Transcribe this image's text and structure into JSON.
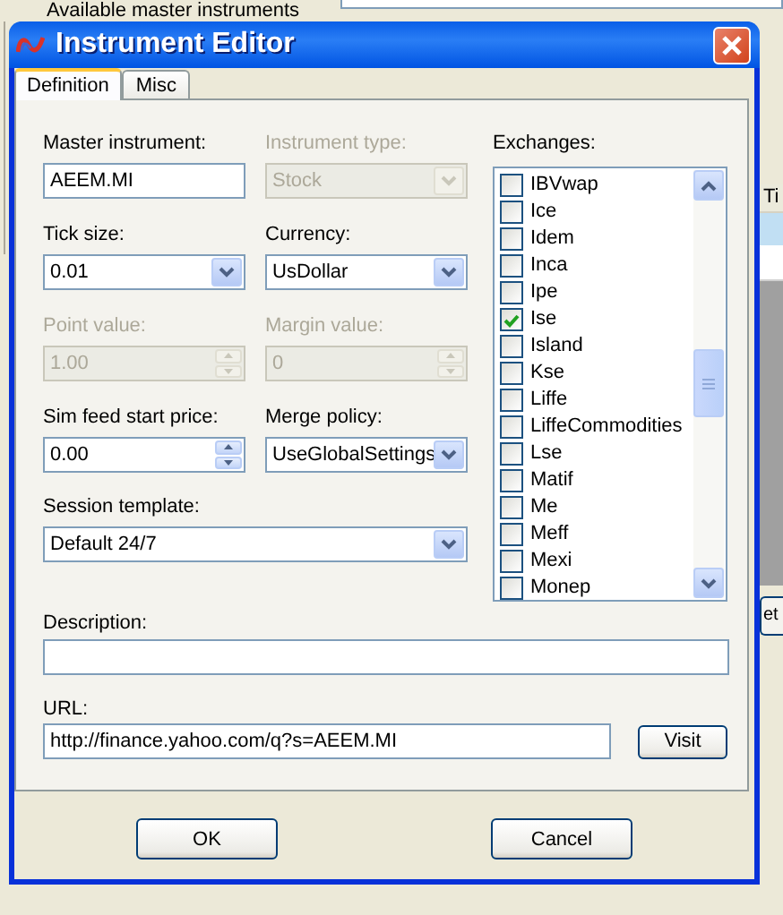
{
  "background": {
    "list_title": "Available master instruments",
    "column_header": "Ti",
    "button": "et"
  },
  "window": {
    "title": "Instrument Editor"
  },
  "tabs": [
    {
      "label": "Definition",
      "selected": true
    },
    {
      "label": "Misc",
      "selected": false
    }
  ],
  "fields": [
    {
      "kind": "text",
      "label": "Master instrument:",
      "value": "AEEM.MI",
      "disabled": false
    },
    {
      "kind": "dropdown",
      "label": "Instrument type:",
      "value": "Stock",
      "disabled": true
    },
    {
      "kind": "dropdown",
      "label": "Tick size:",
      "value": "0.01",
      "disabled": false
    },
    {
      "kind": "dropdown",
      "label": "Currency:",
      "value": "UsDollar",
      "disabled": false
    },
    {
      "kind": "spin",
      "label": "Point value:",
      "value": "1.00",
      "disabled": true
    },
    {
      "kind": "spin",
      "label": "Margin value:",
      "value": "0",
      "disabled": true
    },
    {
      "kind": "spin",
      "label": "Sim feed start price:",
      "value": "0.00",
      "disabled": false
    },
    {
      "kind": "dropdown",
      "label": "Merge policy:",
      "value": "UseGlobalSettings",
      "disabled": false
    },
    {
      "kind": "dropdown",
      "label": "Session template:",
      "value": "Default 24/7",
      "disabled": false
    }
  ],
  "exchanges": {
    "label": "Exchanges:",
    "items": [
      {
        "name": "IBVwap",
        "checked": false
      },
      {
        "name": "Ice",
        "checked": false
      },
      {
        "name": "Idem",
        "checked": false
      },
      {
        "name": "Inca",
        "checked": false
      },
      {
        "name": "Ipe",
        "checked": false
      },
      {
        "name": "Ise",
        "checked": true
      },
      {
        "name": "Island",
        "checked": false
      },
      {
        "name": "Kse",
        "checked": false
      },
      {
        "name": "Liffe",
        "checked": false
      },
      {
        "name": "LiffeCommodities",
        "checked": false
      },
      {
        "name": "Lse",
        "checked": false
      },
      {
        "name": "Matif",
        "checked": false
      },
      {
        "name": "Me",
        "checked": false
      },
      {
        "name": "Meff",
        "checked": false
      },
      {
        "name": "Mexi",
        "checked": false
      },
      {
        "name": "Monep",
        "checked": false
      }
    ]
  },
  "description": {
    "label": "Description:"
  },
  "url": {
    "label": "URL:",
    "value": "http://finance.yahoo.com/q?s=AEEM.MI",
    "button": "Visit"
  },
  "buttons": [
    "OK",
    "Cancel"
  ]
}
